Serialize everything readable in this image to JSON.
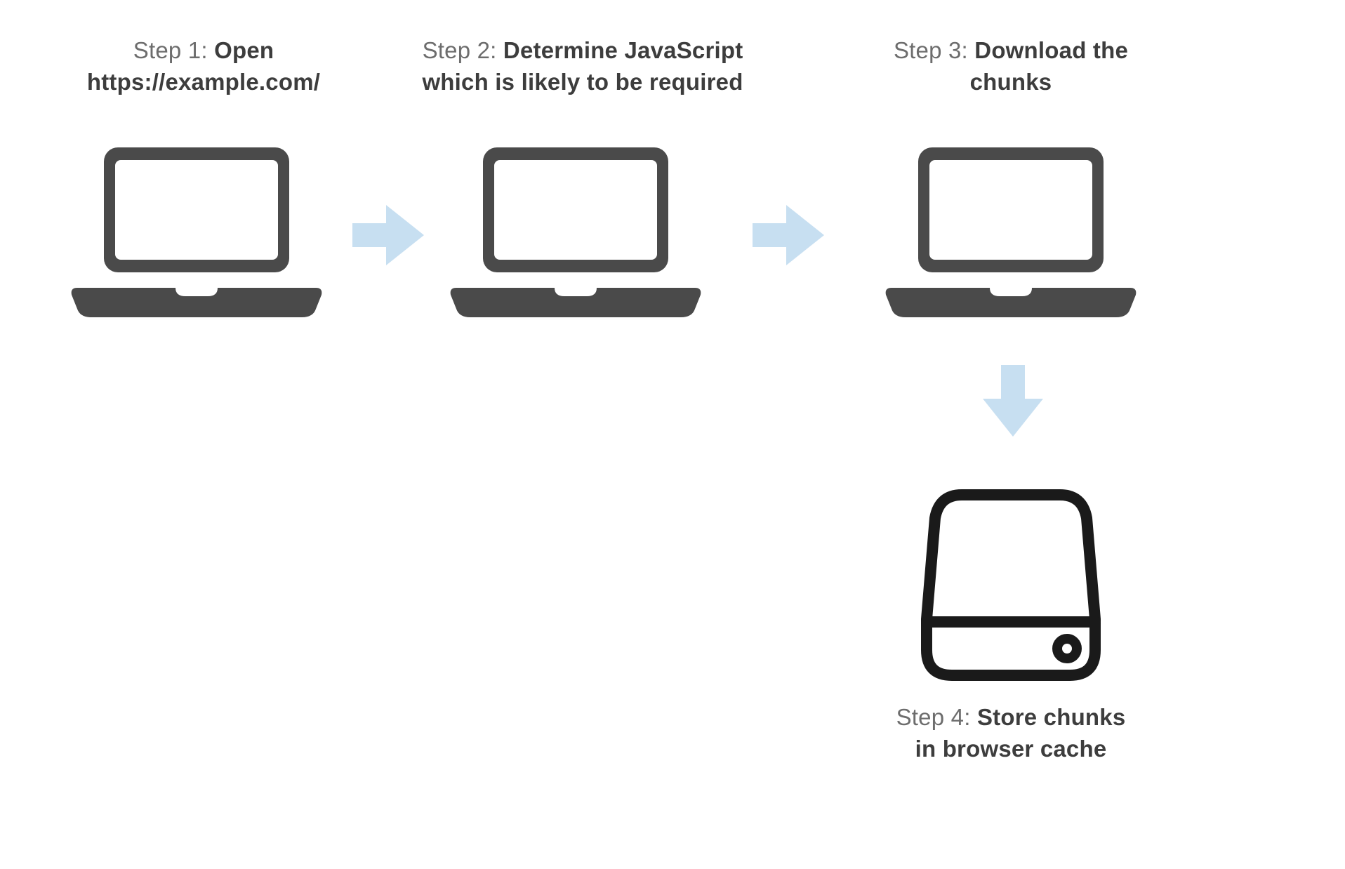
{
  "diagram": {
    "colors": {
      "text_muted": "#6d6d6d",
      "text_bold": "#3d3d3d",
      "icon_dark": "#4a4a4a",
      "arrow": "#c7dff1",
      "drive_stroke": "#1a1a1a"
    },
    "steps": [
      {
        "label": "Step 1: ",
        "bold_line1": "Open",
        "bold_line2": "https://example.com/",
        "icon": "laptop"
      },
      {
        "label": "Step 2: ",
        "bold_line1": "Determine JavaScript",
        "bold_line2": "which is likely to be required",
        "icon": "laptop"
      },
      {
        "label": "Step 3: ",
        "bold_line1": "Download the",
        "bold_line2": "chunks",
        "icon": "laptop"
      },
      {
        "label": "Step 4: ",
        "bold_line1": "Store chunks",
        "bold_line2": "in browser cache",
        "icon": "hard-drive"
      }
    ],
    "arrows": [
      {
        "from": 1,
        "to": 2,
        "direction": "right"
      },
      {
        "from": 2,
        "to": 3,
        "direction": "right"
      },
      {
        "from": 3,
        "to": 4,
        "direction": "down"
      }
    ]
  }
}
